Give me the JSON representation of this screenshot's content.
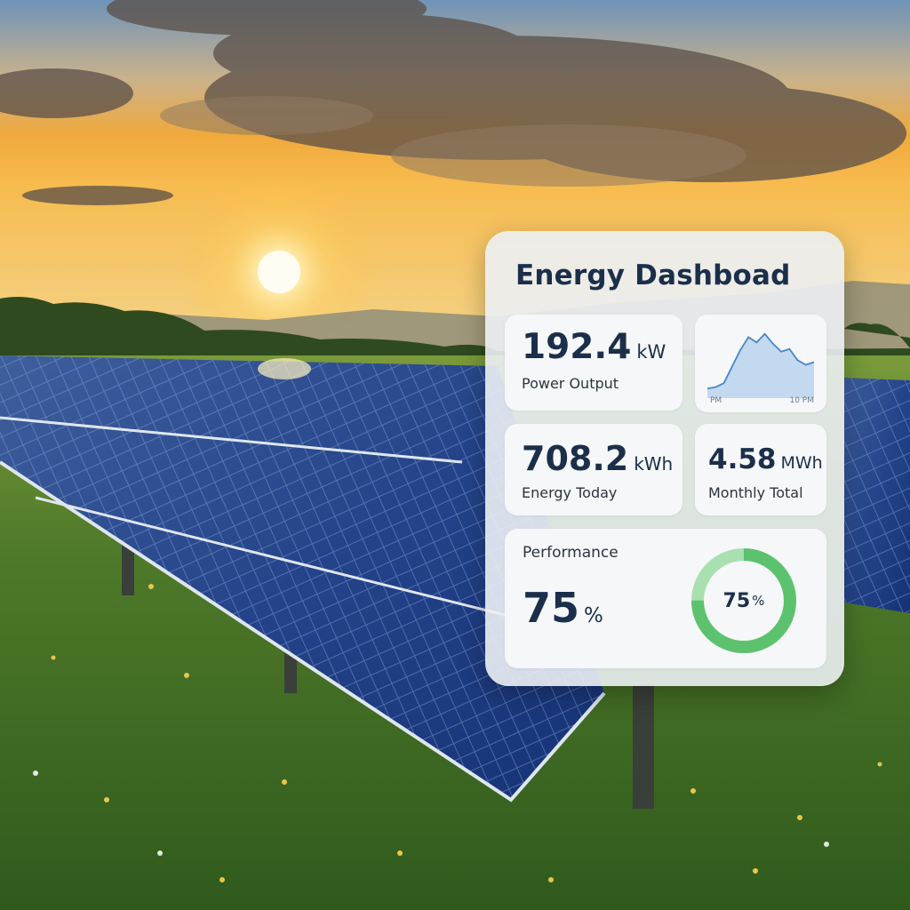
{
  "dashboard": {
    "title": "Energy Dashboad",
    "power_output": {
      "value": "192.4",
      "unit": "kW",
      "label": "Power Output"
    },
    "sparkline": {
      "start_label": "PM",
      "end_label": "10 PM",
      "values": [
        0.12,
        0.14,
        0.2,
        0.45,
        0.7,
        0.9,
        0.82,
        0.95,
        0.8,
        0.68,
        0.72,
        0.55,
        0.48,
        0.52
      ]
    },
    "energy_today": {
      "value": "708.2",
      "unit": "kWh",
      "label": "Energy Today"
    },
    "monthly_total": {
      "value": "4.58",
      "unit": "MWh",
      "label": "Monthly Total"
    },
    "performance": {
      "label": "Performance",
      "value": "75",
      "unit": "%",
      "ring_value": "75",
      "ring_unit": "%",
      "fraction": 0.75
    }
  },
  "colors": {
    "title": "#1b2f4a",
    "spark_line": "#4a86c8",
    "spark_fill": "#b9d3ee",
    "ring_fill": "#5cc26e",
    "ring_track": "#a8e0b0"
  }
}
